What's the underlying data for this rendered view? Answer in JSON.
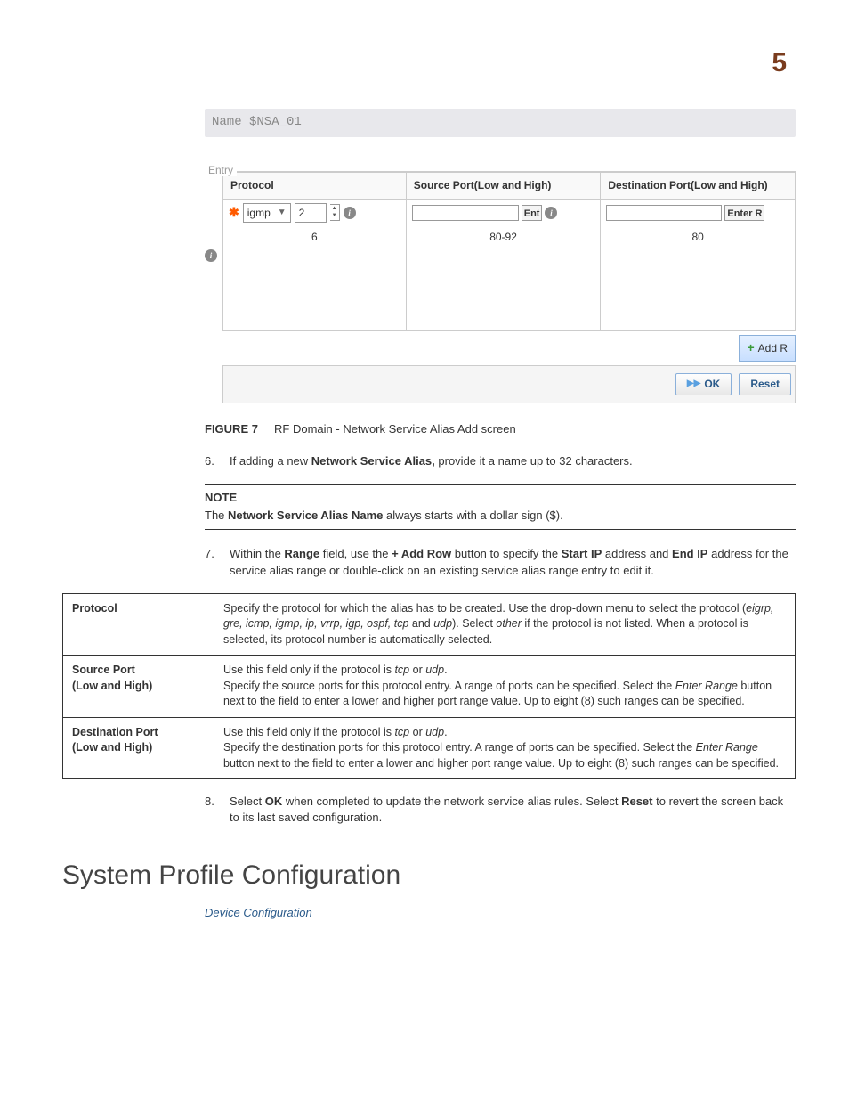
{
  "page_number": "5",
  "screenshot": {
    "name_bar": "Name $NSA_01",
    "entry_legend": "Entry",
    "columns": {
      "protocol": "Protocol",
      "source_port": "Source Port(Low and High)",
      "dest_port": "Destination Port(Low and High)"
    },
    "row1": {
      "protocol_value": "igmp",
      "protocol_num": "2",
      "source_btn": "Ent",
      "dest_btn": "Enter R"
    },
    "row2": {
      "protocol_num": "6",
      "source_port": "80-92",
      "dest_port": "80"
    },
    "add_row_label": "Add R",
    "ok_label": "OK",
    "reset_label": "Reset"
  },
  "figure": {
    "label": "FIGURE 7",
    "caption": "RF Domain - Network Service Alias Add screen"
  },
  "step6": {
    "num": "6.",
    "text_a": "If adding a new ",
    "bold": "Network Service Alias,",
    "text_b": " provide it a name up to 32 characters."
  },
  "note": {
    "label": "NOTE",
    "text_a": "The ",
    "bold": "Network Service Alias Name",
    "text_b": " always starts with a dollar sign ($)."
  },
  "step7": {
    "num": "7.",
    "text_a": "Within the ",
    "bold1": "Range",
    "text_b": " field, use the ",
    "bold2": "+ Add Row",
    "text_c": " button to specify the ",
    "bold3": "Start IP",
    "text_d": " address and ",
    "bold4": "End IP",
    "text_e": " address for the service alias range or double-click on an existing service alias range entry to edit it."
  },
  "param_table": {
    "r1": {
      "name": "Protocol",
      "t1": "Specify the protocol for which the alias has to be created. Use the drop-down menu to select the protocol (",
      "i1": "eigrp, gre, icmp, igmp, ip, vrrp, igp, ospf, tcp",
      "t2": " and ",
      "i2": "udp",
      "t3": "). Select ",
      "i3": "other",
      "t4": " if the protocol is not listed. When a protocol is selected, its protocol number is automatically selected."
    },
    "r2": {
      "name_a": "Source Port",
      "name_b": "(Low and High)",
      "t1": "Use this field only if the protocol is ",
      "i1": "tcp",
      "t2": " or ",
      "i2": "udp",
      "t3": ".",
      "t4": "Specify the source ports for this protocol entry. A range of ports can be specified. Select the ",
      "i3": "Enter Range",
      "t5": " button next to the field to enter a lower and higher port range value. Up to eight (8) such ranges can be specified."
    },
    "r3": {
      "name_a": "Destination Port",
      "name_b": "(Low and High)",
      "t1": "Use this field only if the protocol is ",
      "i1": "tcp",
      "t2": " or ",
      "i2": "udp",
      "t3": ".",
      "t4": "Specify the destination ports for this protocol entry. A range of ports can be specified. Select the ",
      "i3": "Enter Range",
      "t5": " button next to the field to enter a lower and higher port range value. Up to eight (8) such ranges can be specified."
    }
  },
  "step8": {
    "num": "8.",
    "text_a": "Select ",
    "bold1": "OK",
    "text_b": " when completed to update the network service alias rules. Select ",
    "bold2": "Reset",
    "text_c": " to revert the screen back to its last saved configuration."
  },
  "heading": "System Profile Configuration",
  "link": "Device Configuration"
}
